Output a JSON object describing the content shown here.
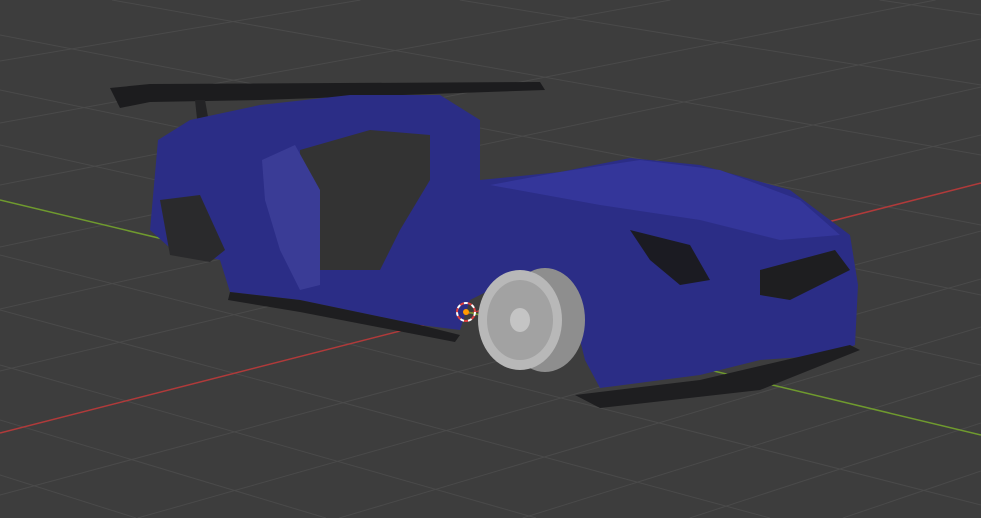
{
  "viewport": {
    "background_color": "#3d3d3d",
    "grid_color": "#4a4a4a",
    "x_axis_color": "#b03a3a",
    "y_axis_color": "#6f9a2e"
  },
  "model": {
    "body_color": "#2b2d86",
    "trim_color": "#1e1e20",
    "wheel_color": "#b4b4b4"
  },
  "cursor": {
    "icon": "3d-cursor-icon",
    "ring_colors": [
      "#e04040",
      "#ffffff"
    ],
    "origin_color": "#ff9a00"
  }
}
